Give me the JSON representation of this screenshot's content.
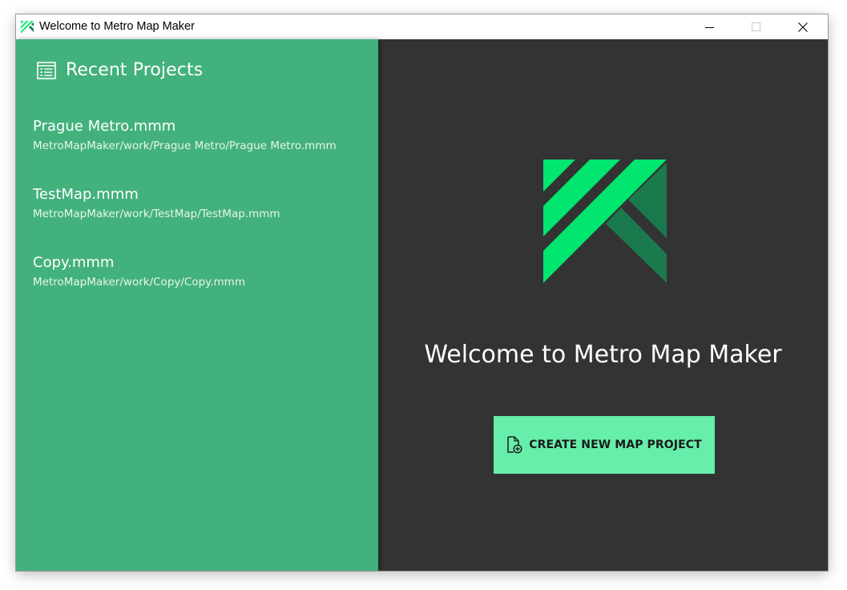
{
  "window": {
    "title": "Welcome to Metro Map Maker",
    "app_icon": "metro-map-maker-logo-icon",
    "controls": {
      "minimize_icon": "minimize-icon",
      "maximize_icon": "maximize-icon",
      "close_icon": "close-icon"
    }
  },
  "sidebar": {
    "icon": "list-icon",
    "title": "Recent Projects",
    "background": "#43b17c",
    "projects": [
      {
        "name": "Prague Metro.mmm",
        "path": "MetroMapMaker/work/Prague Metro/Prague Metro.mmm"
      },
      {
        "name": "TestMap.mmm",
        "path": "MetroMapMaker/work/TestMap/TestMap.mmm"
      },
      {
        "name": "Copy.mmm",
        "path": "MetroMapMaker/work/Copy/Copy.mmm"
      }
    ]
  },
  "main": {
    "background": "#333333",
    "logo": "metro-map-maker-logo",
    "welcome_text": "Welcome to Metro Map Maker",
    "create_button": {
      "label": "CREATE NEW MAP PROJECT",
      "icon": "new-file-icon",
      "background": "#66eeaa"
    }
  }
}
